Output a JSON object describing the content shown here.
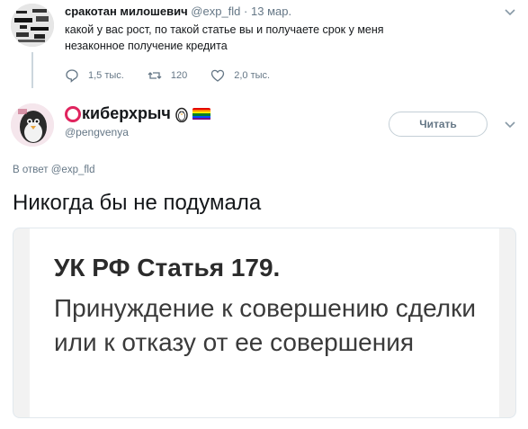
{
  "parent_tweet": {
    "name": "сракотан милошевич",
    "handle": "@exp_fld",
    "separator": "·",
    "date": "13 мар.",
    "text": "какой у вас рост, по такой статье вы и получаете срок у меня незаконное получение кредита",
    "replies": "1,5 тыс.",
    "retweets": "120",
    "likes": "2,0 тыс."
  },
  "tweet": {
    "name": "киберхрыч",
    "handle": "@pengvenya",
    "follow_label": "Читать",
    "reply_prefix": "В ответ",
    "reply_handle": "@exp_fld",
    "text": "Никогда бы не подумала"
  },
  "image_card": {
    "title": "УК РФ Статья 179.",
    "body": "Принуждение к совершению сделки или к отказу от ее совершения"
  },
  "colors": {
    "accent_red": "#e0245e",
    "muted": "#657786",
    "border": "#e1e8ed"
  }
}
